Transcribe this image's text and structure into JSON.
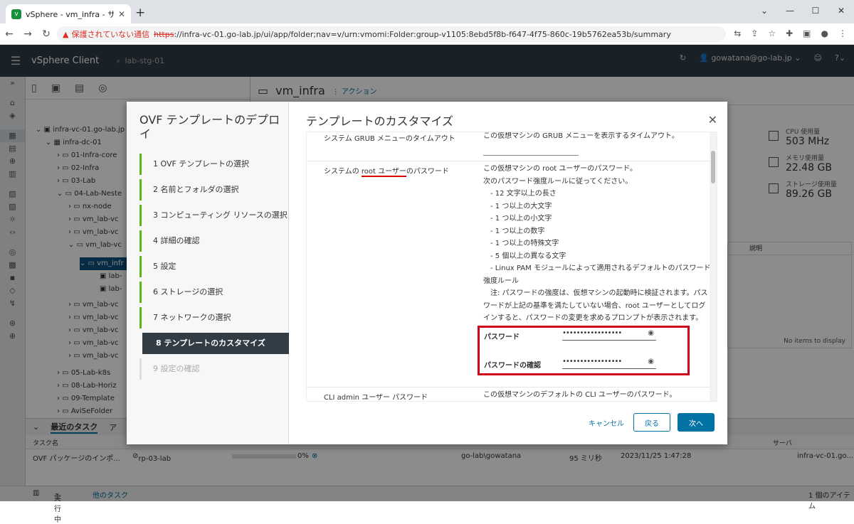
{
  "browser": {
    "tab_title": "vSphere - vm_infra - サマリ",
    "not_secure": "保護されていない通信",
    "url_scheme": "https",
    "url_rest": "://infra-vc-01.go-lab.jp/ui/app/folder;nav=v/urn:vmomi:Folder:group-v1105:8ebd5f8b-f647-4f75-860c-19b5762ea53b/summary"
  },
  "vsphere": {
    "app_title": "vSphere Client",
    "search_text": "lab-stg-01",
    "user": "gowatana@go-lab.jp"
  },
  "tree": {
    "items": [
      {
        "label": "infra-vc-01.go-lab.jp"
      },
      {
        "label": "infra-dc-01"
      },
      {
        "label": "01-Infra-core"
      },
      {
        "label": "02-Infra"
      },
      {
        "label": "03-Lab"
      },
      {
        "label": "04-Lab-Neste"
      },
      {
        "label": "nx-node"
      },
      {
        "label": "vm_lab-vc"
      },
      {
        "label": "vm_lab-vc"
      },
      {
        "label": "vm_lab-vc"
      },
      {
        "label": "vm_infr"
      },
      {
        "label": "lab-"
      },
      {
        "label": "lab-"
      },
      {
        "label": "vm_lab-vc"
      },
      {
        "label": "vm_lab-vc"
      },
      {
        "label": "vm_lab-vc"
      },
      {
        "label": "vm_lab-vc"
      },
      {
        "label": "vm_lab-vc"
      },
      {
        "label": "05-Lab-k8s"
      },
      {
        "label": "08-Lab-Horiz"
      },
      {
        "label": "09-Template"
      },
      {
        "label": "AviSeFolder"
      }
    ]
  },
  "main": {
    "breadcrumb": "vm_infra",
    "actions": "アクション",
    "cpu_label": "CPU 使用量",
    "cpu_value": "503 MHz",
    "mem_label": "メモリ使用量",
    "mem_value": "22.48 GB",
    "storage_label": "ストレージ使用量",
    "storage_value": "89.26 GB",
    "notes_header": "説明",
    "no_items": "No items to display"
  },
  "tasks": {
    "tab_recent": "最近のタスク",
    "tab_alarm": "ア",
    "col_task": "タスク名",
    "col_server": "サーバ",
    "row": {
      "task": "OVF パッケージのインポ...",
      "target": "rp-03-lab",
      "progress": "0%",
      "initiator": "go-lab\\gowatana",
      "queued": "95 ミリ秒",
      "start": "2023/11/25 1:47:28",
      "server": "infra-vc-01.go..."
    },
    "running": "実行中",
    "other_tasks": "他のタスク",
    "item_count": "1 個のアイテム"
  },
  "wizard": {
    "title": "OVF テンプレートのデプロイ",
    "steps": [
      {
        "label": "1  OVF テンプレートの選択"
      },
      {
        "label": "2  名前とフォルダの選択"
      },
      {
        "label": "3  コンピューティング リソースの選択"
      },
      {
        "label": "4  詳細の確認"
      },
      {
        "label": "5  設定"
      },
      {
        "label": "6  ストレージの選択"
      },
      {
        "label": "7  ネットワークの選択"
      },
      {
        "label": "8  テンプレートのカスタマイズ"
      },
      {
        "label": "9  設定の確認"
      }
    ],
    "page_title": "テンプレートのカスタマイズ",
    "grub_name": "システム GRUB メニューのタイムアウト",
    "grub_desc": "この仮想マシンの GRUB メニューを表示するタイムアウト。",
    "root_name_pre": "システムの ",
    "root_name_mark": "root ユーザー",
    "root_name_post": "のパスワード",
    "root_desc_lines": [
      "この仮想マシンの root ユーザーのパスワード。",
      "次のパスワード強度ルールに従ってください。",
      "　- 12 文字以上の長さ",
      "　- 1 つ以上の大文字",
      "　- 1 つ以上の小文字",
      "　- 1 つ以上の数字",
      "　- 1 つ以上の特殊文字",
      "　- 5 個以上の異なる文字",
      "　- Linux PAM モジュールによって適用されるデフォルトのパスワード強度ルール",
      "　注: パスワードの強度は、仮想マシンの起動時に検証されます。パスワードが上記の基準を満たしていない場合、root ユーザーとしてログインすると、パスワードの変更を求めるプロンプトが表示されます。"
    ],
    "password_label": "パスワード",
    "password_value": "•••••••••••••••••",
    "confirm_label": "パスワードの確認",
    "confirm_value": "•••••••••••••••••",
    "cli_name": "CLI admin ユーザー パスワード",
    "cli_desc": "この仮想マシンのデフォルトの CLI ユーザーのパスワード。",
    "cancel": "キャンセル",
    "back": "戻る",
    "next": "次へ"
  }
}
